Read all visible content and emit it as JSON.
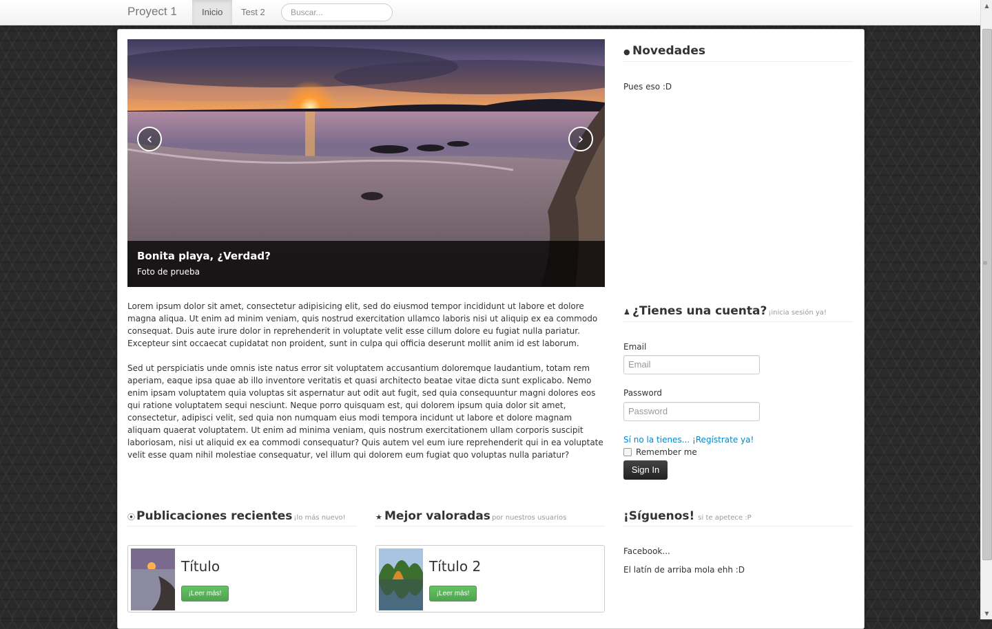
{
  "navbar": {
    "brand": "Proyect 1",
    "items": [
      {
        "label": "Inicio",
        "active": true
      },
      {
        "label": "Test 2",
        "active": false
      }
    ],
    "search_placeholder": "Buscar..."
  },
  "carousel": {
    "caption_title": "Bonita playa, ¿Verdad?",
    "caption_text": "Foto de prueba",
    "prev_icon": "chevron-left-icon",
    "next_icon": "chevron-right-icon"
  },
  "main": {
    "paragraphs": [
      "Lorem ipsum dolor sit amet, consectetur adipisicing elit, sed do eiusmod tempor incididunt ut labore et dolore magna aliqua. Ut enim ad minim veniam, quis nostrud exercitation ullamco laboris nisi ut aliquip ex ea commodo consequat. Duis aute irure dolor in reprehenderit in voluptate velit esse cillum dolore eu fugiat nulla pariatur. Excepteur sint occaecat cupidatat non proident, sunt in culpa qui officia deserunt mollit anim id est laborum.",
      "Sed ut perspiciatis unde omnis iste natus error sit voluptatem accusantium doloremque laudantium, totam rem aperiam, eaque ipsa quae ab illo inventore veritatis et quasi architecto beatae vitae dicta sunt explicabo. Nemo enim ipsam voluptatem quia voluptas sit aspernatur aut odit aut fugit, sed quia consequuntur magni dolores eos qui ratione voluptatem sequi nesciunt. Neque porro quisquam est, qui dolorem ipsum quia dolor sit amet, consectetur, adipisci velit, sed quia non numquam eius modi tempora incidunt ut labore et dolore magnam aliquam quaerat voluptatem. Ut enim ad minima veniam, quis nostrum exercitationem ullam corporis suscipit laboriosam, nisi ut aliquid ex ea commodi consequatur? Quis autem vel eum iure reprehenderit qui in ea voluptate velit esse quam nihil molestiae consequatur, vel illum qui dolorem eum fugiat quo voluptas nulla pariatur?"
    ]
  },
  "novedades": {
    "icon": "info-icon",
    "title": "Novedades",
    "text": "Pues eso :D"
  },
  "login": {
    "icon": "user-icon",
    "title": "¿Tienes una cuenta?",
    "subtitle": "¡inicia sesión ya!",
    "email_label": "Email",
    "email_placeholder": "Email",
    "password_label": "Password",
    "password_placeholder": "Password",
    "register_link": "Sí no la tienes... ¡Regístrate ya!",
    "remember_label": "Remember me",
    "sign_in": "Sign In"
  },
  "recent": {
    "icon": "circle-arrow-up-icon",
    "title": "Publicaciones recientes",
    "subtitle": "¡lo más nuevo!",
    "card_title": "Título",
    "button": "¡Leer más!"
  },
  "top_rated": {
    "icon": "star-icon",
    "title": "Mejor valoradas",
    "subtitle": "por nuestros usuarios",
    "card_title": "Título 2",
    "button": "¡Leer más!"
  },
  "follow": {
    "title": "¡Síguenos!",
    "subtitle": "si te apetece :P",
    "line1": "Facebook...",
    "line2": "El latín de arriba mola ehh :D"
  },
  "colors": {
    "link": "#0088cc",
    "success": "#5bb75b",
    "inverse": "#222222"
  }
}
